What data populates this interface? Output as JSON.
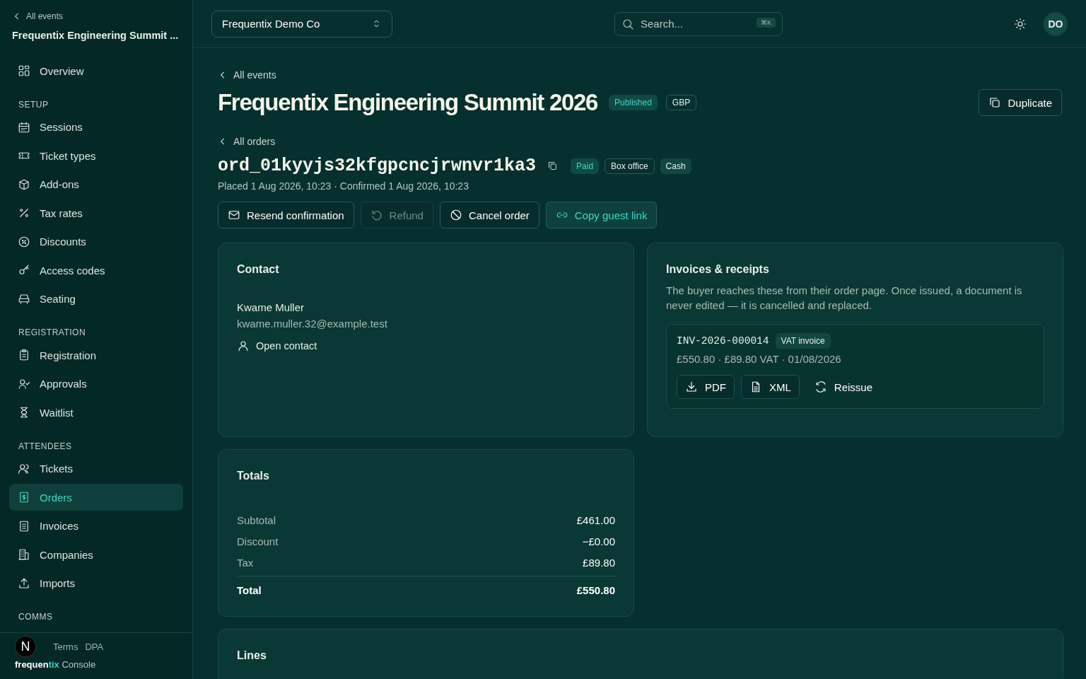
{
  "sidebar": {
    "back_link": "All events",
    "event_title": "Frequentix Engineering Summit ...",
    "sections": [
      {
        "items": [
          {
            "label": "Overview",
            "selected": false
          }
        ]
      },
      {
        "heading": "SETUP",
        "items": [
          {
            "label": "Sessions",
            "selected": false
          },
          {
            "label": "Ticket types",
            "selected": false
          },
          {
            "label": "Add-ons",
            "selected": false
          },
          {
            "label": "Tax rates",
            "selected": false
          },
          {
            "label": "Discounts",
            "selected": false
          },
          {
            "label": "Access codes",
            "selected": false
          },
          {
            "label": "Seating",
            "selected": false
          }
        ]
      },
      {
        "heading": "REGISTRATION",
        "items": [
          {
            "label": "Registration",
            "selected": false
          },
          {
            "label": "Approvals",
            "selected": false
          },
          {
            "label": "Waitlist",
            "selected": false
          }
        ]
      },
      {
        "heading": "ATTENDEES",
        "items": [
          {
            "label": "Tickets",
            "selected": false
          },
          {
            "label": "Orders",
            "selected": true
          },
          {
            "label": "Invoices",
            "selected": false
          },
          {
            "label": "Companies",
            "selected": false
          },
          {
            "label": "Imports",
            "selected": false
          }
        ]
      },
      {
        "heading": "COMMS"
      }
    ],
    "footer_links": [
      "Terms",
      "DPA"
    ],
    "brand": {
      "bold": "frequen",
      "accent": "tix",
      "rest": "Console"
    },
    "overlay_badge": "N"
  },
  "topbar": {
    "org_selector": "Frequentix Demo Co",
    "search": {
      "placeholder": "Search...",
      "shortcut": "⌘K"
    },
    "avatar": "DO"
  },
  "event": {
    "back_link": "All events",
    "title": "Frequentix Engineering Summit 2026",
    "badges": [
      {
        "label": "Published",
        "kind": "accent"
      },
      {
        "label": "GBP",
        "kind": "outline"
      }
    ],
    "duplicate_button": "Duplicate"
  },
  "order": {
    "back_link": "All orders",
    "id": "ord_01kyyjs32kfgpcncjrwnvr1ka3",
    "badges": [
      {
        "label": "Paid",
        "kind": "accent"
      },
      {
        "label": "Box office",
        "kind": "outline"
      },
      {
        "label": "Cash",
        "kind": "muted"
      }
    ],
    "meta": "Placed 1 Aug 2026, 10:23 · Confirmed 1 Aug 2026, 10:23",
    "actions": [
      {
        "label": "Resend confirmation",
        "kind": "default",
        "disabled": false
      },
      {
        "label": "Refund",
        "kind": "default",
        "disabled": true
      },
      {
        "label": "Cancel order",
        "kind": "default",
        "disabled": false
      },
      {
        "label": "Copy guest link",
        "kind": "accent",
        "disabled": false
      }
    ]
  },
  "contact": {
    "title": "Contact",
    "name": "Kwame Muller",
    "email": "kwame.muller.32@example.test",
    "link": "Open contact"
  },
  "invoices": {
    "title": "Invoices & receipts",
    "description": "The buyer reaches these from their order page. Once issued, a document is never edited — it is cancelled and replaced.",
    "documents": [
      {
        "number": "INV-2026-000014",
        "type": "VAT invoice",
        "summary": "£550.80 · £89.80 VAT · 01/08/2026",
        "actions": [
          {
            "label": "PDF",
            "kind": "outline"
          },
          {
            "label": "XML",
            "kind": "outline"
          },
          {
            "label": "Reissue",
            "kind": "plain"
          }
        ]
      }
    ]
  },
  "totals": {
    "title": "Totals",
    "rows": [
      {
        "label": "Subtotal",
        "value": "£461.00",
        "kind": "line"
      },
      {
        "label": "Discount",
        "value": "−£0.00",
        "kind": "line"
      },
      {
        "label": "Tax",
        "value": "£89.80",
        "kind": "line"
      },
      {
        "label": "Total",
        "value": "£550.80",
        "kind": "total"
      }
    ]
  },
  "lines": {
    "title": "Lines"
  }
}
